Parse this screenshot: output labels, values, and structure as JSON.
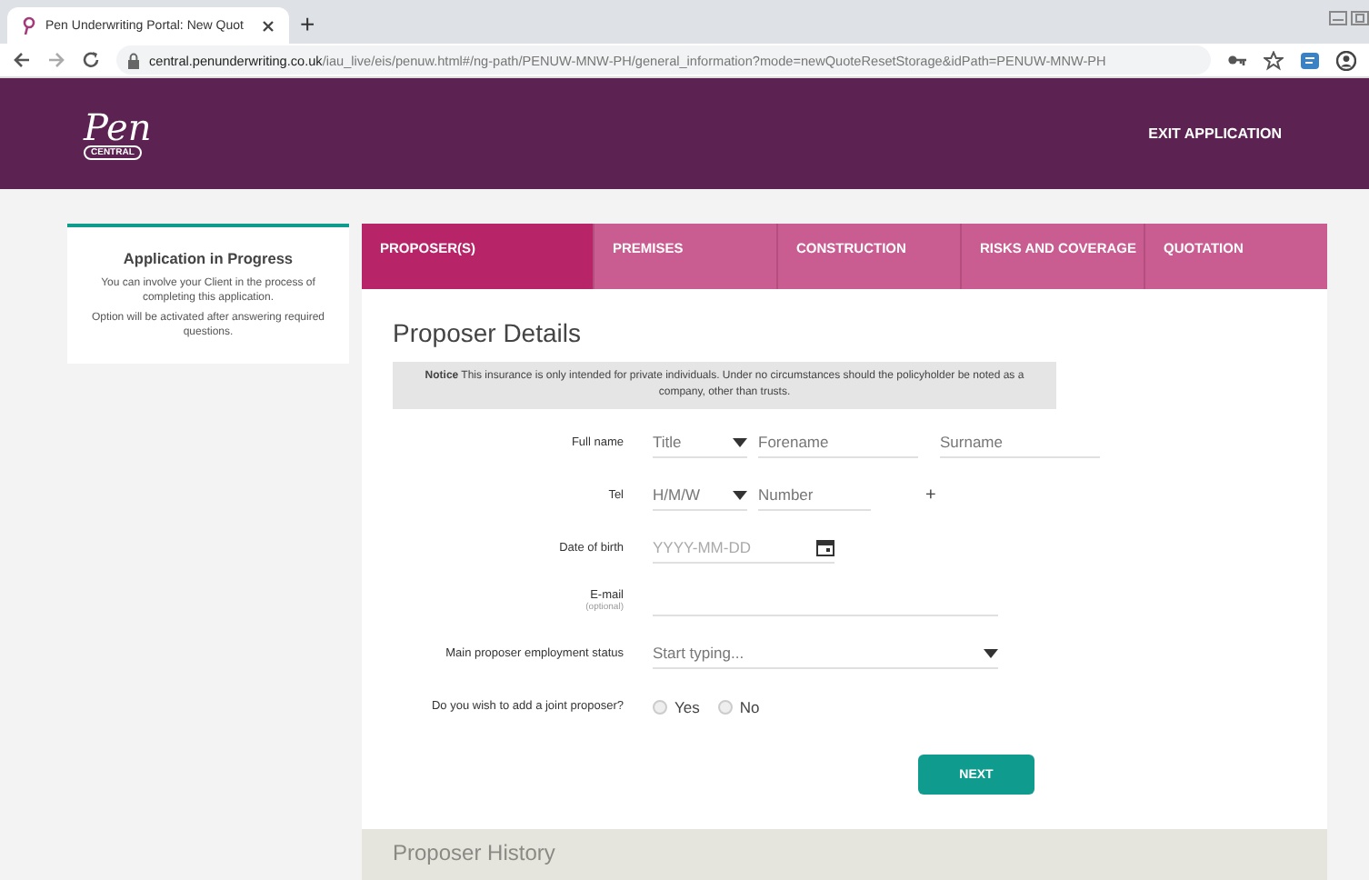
{
  "browser": {
    "tab_title": "Pen Underwriting Portal: New Quot",
    "new_tab": "+",
    "url_host": "central.penunderwriting.co.uk",
    "url_path": "/iau_live/eis/penuw.html#/ng-path/PENUW-MNW-PH/general_information?mode=newQuoteResetStorage&idPath=PENUW-MNW-PH"
  },
  "header": {
    "logo": "Pen",
    "logo_sub": "CENTRAL",
    "exit": "EXIT APPLICATION"
  },
  "side_card": {
    "title": "Application in Progress",
    "lines": [
      "You can involve your Client in the process of completing this application.",
      "Option will be activated after answering required questions."
    ]
  },
  "steps": [
    {
      "label": "PROPOSER(S)",
      "selected": true
    },
    {
      "label": "PREMISES",
      "selected": false
    },
    {
      "label": "CONSTRUCTION",
      "selected": false
    },
    {
      "label": "RISKS AND COVERAGE",
      "selected": false
    },
    {
      "label": "QUOTATION",
      "selected": false
    }
  ],
  "section_title": "Proposer Details",
  "notice": "**Notice** This insurance is only intended for private individuals. Under no circumstances should the policyholder be noted as a company, other than trusts.",
  "fields": [
    {
      "kind": "name",
      "label": "Full name",
      "select": "Title",
      "first": "Forename",
      "second": "Surname"
    },
    {
      "kind": "tel",
      "label": "Tel",
      "select": "H/M/W",
      "first": "Number",
      "add": "+"
    },
    {
      "kind": "date",
      "label": "Date of birth",
      "placeholder": "YYYY-MM-DD"
    },
    {
      "kind": "email",
      "label": "E-mail",
      "sub": "(optional)"
    },
    {
      "kind": "combo",
      "label": "Main proposer employment status",
      "placeholder": "Start typing..."
    },
    {
      "kind": "radio",
      "label": "Do you wish to add a joint proposer?",
      "options": [
        {
          "label": "Yes",
          "selected": false
        },
        {
          "label": "No",
          "selected": false
        }
      ]
    }
  ],
  "next_button": "NEXT",
  "next_section": "Proposer History"
}
